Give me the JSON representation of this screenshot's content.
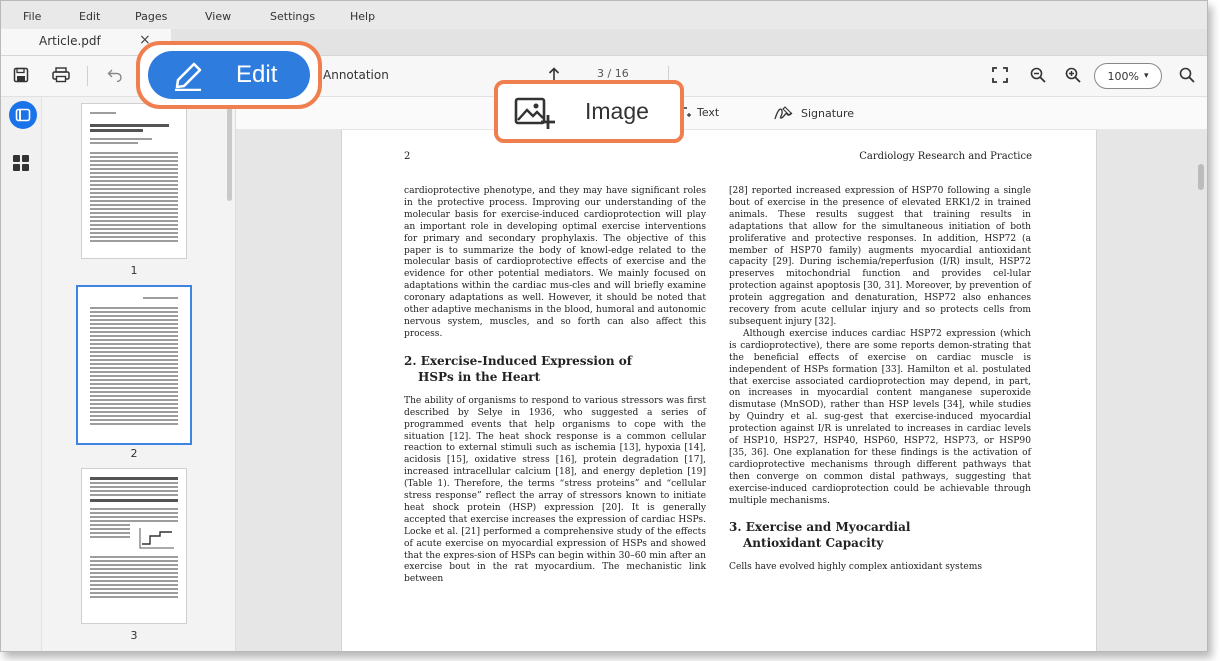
{
  "menu": {
    "items": [
      {
        "label": "File"
      },
      {
        "label": "Edit"
      },
      {
        "label": "Pages"
      },
      {
        "label": "View"
      },
      {
        "label": "Settings"
      },
      {
        "label": "Help"
      }
    ]
  },
  "tabs": [
    {
      "label": "Article.pdf",
      "close_icon": "×"
    }
  ],
  "toolbar": {
    "edit_label": "Edit",
    "annotation_label": "Annotation",
    "page_indicator": "3 / 16",
    "zoom_value": "100%",
    "icons": [
      "save-icon",
      "print-icon",
      "undo-icon",
      "edit-pencil-icon",
      "arrow-up-icon",
      "fullscreen-icon",
      "zoom-out-icon",
      "zoom-in-icon",
      "search-icon"
    ]
  },
  "subtoolbar": {
    "image_label": "Image",
    "text_label": "Text",
    "signature_label": "Signature"
  },
  "accent_color": "#2f7cdf",
  "callout_color": "#f07f4f",
  "thumbnails": {
    "pages": [
      {
        "number": "1",
        "selected": false
      },
      {
        "number": "2",
        "selected": true
      },
      {
        "number": "3",
        "selected": false
      }
    ]
  },
  "document": {
    "page_number": "2",
    "journal": "Cardiology Research and Practice",
    "left_col": {
      "p1": "cardioprotective phenotype, and they may have significant roles in the protective process. Improving our understanding of the molecular basis for exercise-induced cardioprotection will play an important role in developing optimal exercise interventions for primary and secondary prophylaxis. The objective of this paper is to summarize the body of knowl-edge related to the molecular basis of cardioprotective effects of exercise and the evidence for other potential mediators. We mainly focused on adaptations within the cardiac mus-cles and will briefly examine coronary adaptations as well. However, it should be noted that other adaptive mechanisms in the blood, humoral and autonomic nervous system, muscles, and so forth can also affect this process.",
      "h2_line1": "2. Exercise-Induced Expression of",
      "h2_line2": "HSPs in the Heart",
      "p2": "The ability of organisms to respond to various stressors was first described by Selye in 1936, who suggested a series of programmed events that help organisms to cope with the situation [12]. The heat shock response is a common cellular reaction to external stimuli such as ischemia [13], hypoxia [14], acidosis [15], oxidative stress [16], protein degradation [17], increased intracellular calcium [18], and energy depletion [19] (Table 1). Therefore, the terms “stress proteins” and “cellular stress response” reflect the array of stressors known to initiate heat shock protein (HSP) expression [20]. It is generally accepted that exercise increases the expression of cardiac HSPs. Locke et al. [21] performed a comprehensive study of the effects of acute exercise on myocardial expression of HSPs and showed that the expres-sion of HSPs can begin within 30–60 min after an exercise bout in the rat myocardium. The mechanistic link between"
    },
    "right_col": {
      "p1": "[28] reported increased expression of HSP70 following a single bout of exercise in the presence of elevated ERK1/2 in trained animals. These results suggest that training results in adaptations that allow for the simultaneous initiation of both proliferative and protective responses. In addition, HSP72 (a member of HSP70 family) augments myocardial antioxidant capacity [29]. During ischemia/reperfusion (I/R) insult, HSP72 preserves mitochondrial function and provides cel-lular protection against apoptosis [30, 31]. Moreover, by prevention of protein aggregation and denaturation, HSP72 also enhances recovery from acute cellular injury and so protects cells from subsequent injury [32].",
      "p2": "Although exercise induces cardiac HSP72 expression (which is cardioprotective), there are some reports demon-strating that the beneficial effects of exercise on cardiac muscle is independent of HSPs formation [33]. Hamilton et al. postulated that exercise associated cardioprotection may depend, in part, on increases in myocardial content manganese superoxide dismutase (MnSOD), rather than HSP levels [34], while studies by Quindry et al. sug-gest that exercise-induced myocardial protection against I/R is unrelated to increases in cardiac levels of HSP10, HSP27, HSP40, HSP60, HSP72, HSP73, or HSP90 [35, 36]. One explanation for these findings is the activation of cardioprotective mechanisms through different pathways that then converge on common distal pathways, suggesting that exercise-induced cardioprotection could be achievable through multiple mechanisms.",
      "h3_line1": "3. Exercise and Myocardial",
      "h3_line2": "Antioxidant Capacity",
      "p3": "Cells have evolved highly complex antioxidant systems"
    }
  }
}
